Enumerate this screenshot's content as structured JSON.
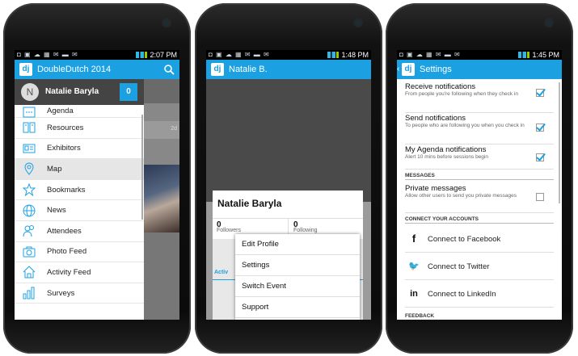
{
  "phone1": {
    "status_time": "2:07 PM",
    "app_title": "DoubleDutch 2014",
    "user": {
      "initial": "N",
      "name": "Natalie Baryla",
      "count": "0"
    },
    "menu": [
      {
        "label": "Agenda",
        "icon": "agenda-icon"
      },
      {
        "label": "Resources",
        "icon": "book-icon"
      },
      {
        "label": "Exhibitors",
        "icon": "id-card-icon"
      },
      {
        "label": "Map",
        "icon": "map-pin-icon"
      },
      {
        "label": "Bookmarks",
        "icon": "star-icon"
      },
      {
        "label": "News",
        "icon": "globe-icon"
      },
      {
        "label": "Attendees",
        "icon": "people-icon"
      },
      {
        "label": "Photo Feed",
        "icon": "camera-icon"
      },
      {
        "label": "Activity Feed",
        "icon": "home-icon"
      },
      {
        "label": "Surveys",
        "icon": "bar-chart-icon"
      }
    ],
    "behind_time": "2d"
  },
  "phone2": {
    "status_time": "1:48 PM",
    "header_title": "Natalie B.",
    "profile_name": "Natalie Baryla",
    "stats": [
      {
        "value": "0",
        "label": "Followers"
      },
      {
        "value": "0",
        "label": "Following"
      }
    ],
    "activity_label": "Activ",
    "popup_items": [
      "Edit Profile",
      "Settings",
      "Switch Event",
      "Support"
    ]
  },
  "phone3": {
    "status_time": "1:45 PM",
    "header_title": "Settings",
    "rows": [
      {
        "title": "Receive notifications",
        "subtitle": "From people you're following when they check in",
        "checked": true
      },
      {
        "title": "Send notifications",
        "subtitle": "To people who are following you when you check in",
        "checked": true
      },
      {
        "title": "My Agenda notifications",
        "subtitle": "Alert 10 mins before sessions begin",
        "checked": true
      }
    ],
    "section_messages": "MESSAGES",
    "private_messages": {
      "title": "Private messages",
      "subtitle": "Allow other users to send you private messages",
      "checked": false
    },
    "section_accounts": "CONNECT YOUR ACCOUNTS",
    "connections": [
      {
        "label": "Connect to Facebook",
        "icon": "facebook-icon",
        "glyph": "f"
      },
      {
        "label": "Connect to Twitter",
        "icon": "twitter-icon",
        "glyph": "🐦"
      },
      {
        "label": "Connect to LinkedIn",
        "icon": "linkedin-icon",
        "glyph": "in"
      }
    ],
    "section_feedback": "FEEDBACK"
  },
  "colors": {
    "accent": "#1ba1e2",
    "drawer_header": "#444444"
  }
}
